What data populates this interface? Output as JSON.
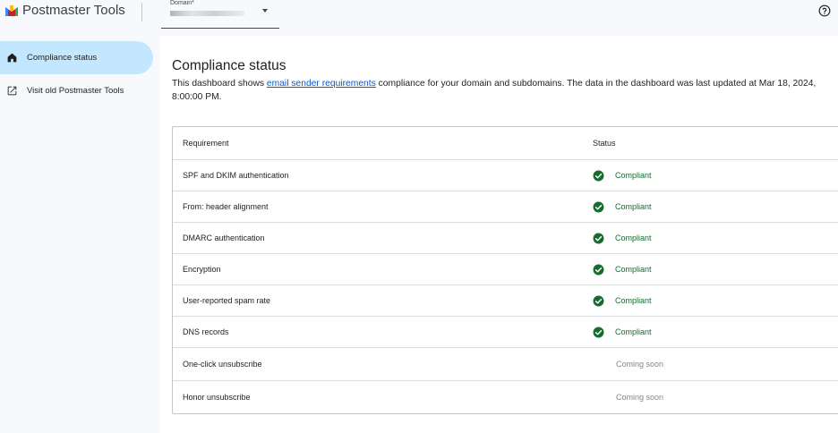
{
  "header": {
    "app_title": "Postmaster Tools",
    "domain_label": "Domain*",
    "help_icon": "help-circle-icon"
  },
  "sidebar": {
    "items": [
      {
        "label": "Compliance status",
        "icon": "home-icon",
        "active": true
      },
      {
        "label": "Visit old Postmaster Tools",
        "icon": "open-in-new-icon",
        "active": false
      }
    ]
  },
  "main": {
    "title": "Compliance status",
    "intro_before": "This dashboard shows ",
    "intro_link": "email sender requirements",
    "intro_after": " compliance for your domain and subdomains. The data in the dashboard was last updated at Mar 18, 2024, 8:00:00 PM.",
    "table": {
      "headers": {
        "requirement": "Requirement",
        "status": "Status"
      },
      "rows": [
        {
          "requirement": "SPF and DKIM authentication",
          "status": "Compliant"
        },
        {
          "requirement": "From: header alignment",
          "status": "Compliant"
        },
        {
          "requirement": "DMARC authentication",
          "status": "Compliant"
        },
        {
          "requirement": "Encryption",
          "status": "Compliant"
        },
        {
          "requirement": "User-reported spam rate",
          "status": "Compliant"
        },
        {
          "requirement": "DNS records",
          "status": "Compliant"
        },
        {
          "requirement": "One-click unsubscribe",
          "status": "Coming soon"
        },
        {
          "requirement": "Honor unsubscribe",
          "status": "Coming soon"
        }
      ]
    }
  },
  "colors": {
    "accent": "#c2e7ff",
    "link": "#0b57d0",
    "compliant": "#146c2e",
    "coming_soon": "#80868b"
  }
}
